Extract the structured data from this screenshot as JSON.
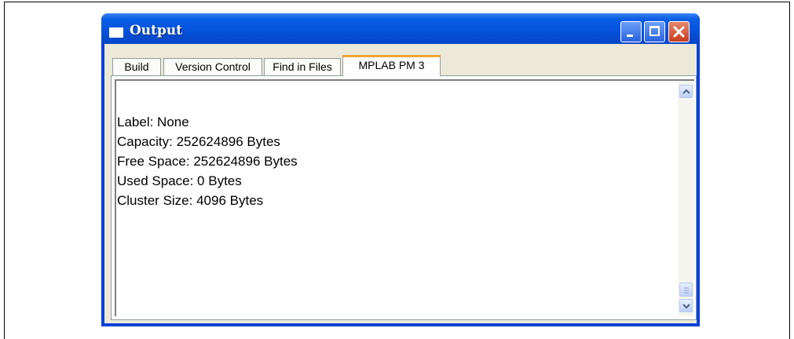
{
  "window": {
    "title": "Output",
    "controls": {
      "minimize": "minimize-icon",
      "maximize": "maximize-icon",
      "close": "close-icon"
    }
  },
  "tabs": [
    {
      "label": "Build",
      "active": false
    },
    {
      "label": "Version Control",
      "active": false
    },
    {
      "label": "Find in Files",
      "active": false
    },
    {
      "label": "MPLAB PM 3",
      "active": true
    }
  ],
  "output": {
    "lines": [
      "Label: None",
      "Capacity: 252624896 Bytes",
      "Free Space: 252624896 Bytes",
      "Used Space: 0 Bytes",
      "Cluster Size: 4096 Bytes"
    ]
  },
  "scrollbar": {
    "up": "chevron-up-icon",
    "down": "chevron-down-icon",
    "thumb": "scroll-thumb"
  }
}
